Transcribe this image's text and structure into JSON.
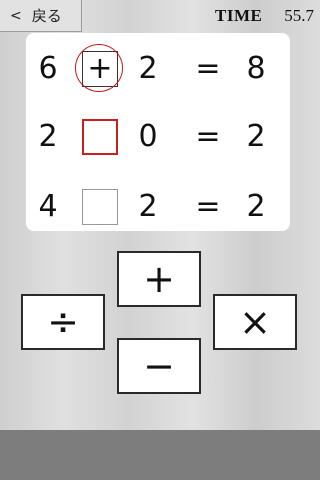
{
  "header": {
    "back_chevron": "<",
    "back_label": "戻る",
    "time_label": "TIME",
    "time_value": "55.7"
  },
  "equations": [
    {
      "left": "6",
      "operator": "+",
      "right": "2",
      "equals": "=",
      "result": "8",
      "state": "answered-correct"
    },
    {
      "left": "2",
      "operator": "",
      "right": "0",
      "equals": "=",
      "result": "2",
      "state": "active"
    },
    {
      "left": "4",
      "operator": "",
      "right": "2",
      "equals": "=",
      "result": "2",
      "state": "empty"
    }
  ],
  "operator_buttons": {
    "plus": "+",
    "divide": "÷",
    "times": "×",
    "minus": "−"
  },
  "colors": {
    "active_slot": "#c81e1e",
    "correct_ring": "#c61a1a",
    "footer": "#7d7d7d"
  }
}
